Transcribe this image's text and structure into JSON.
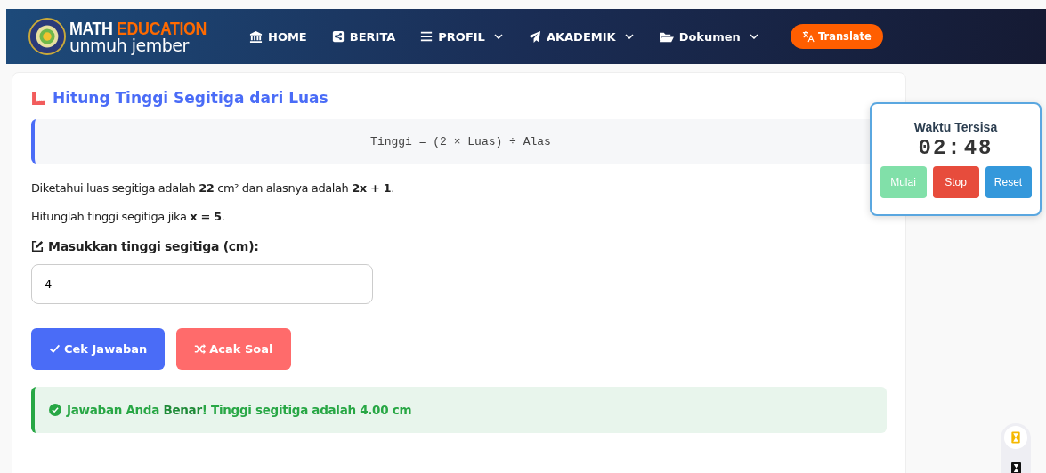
{
  "brand": {
    "word_1": "MATH",
    "word_2": "EDUCATION",
    "subtitle": "unmuh jember"
  },
  "nav": [
    {
      "label": "HOME",
      "kind": "home",
      "dropdown": false
    },
    {
      "label": "BERITA",
      "kind": "news",
      "dropdown": false
    },
    {
      "label": "PROFIL",
      "kind": "profile",
      "dropdown": true
    },
    {
      "label": "AKADEMIK",
      "kind": "academic",
      "dropdown": true
    },
    {
      "label": "Dokumen",
      "kind": "documents",
      "dropdown": true
    }
  ],
  "translate_button": "Translate",
  "card": {
    "title": "Hitung Tinggi Segitiga dari Luas",
    "formula": "Tinggi = (2 × Luas) ÷ Alas",
    "paragraphs": [
      "Diketahui luas segitiga adalah **22** cm² dan alasnya adalah **2x + 1**.",
      "Hitunglah tinggi segitiga jika **x = 5**."
    ],
    "input_label": "Masukkan tinggi segitiga (cm):",
    "input_value": "4",
    "buttons": [
      {
        "label": "Cek Jawaban",
        "kind": "check"
      },
      {
        "label": "Acak Soal",
        "kind": "shuffle"
      }
    ],
    "result": {
      "correct": true,
      "text": "Jawaban Anda **Benar**! Tinggi segitiga adalah 4.00 cm"
    }
  },
  "timer": {
    "title": "Waktu Tersisa",
    "time": "02:48",
    "buttons": [
      {
        "label": "Mulai",
        "kind": "start",
        "disabled": true
      },
      {
        "label": "Stop",
        "kind": "stop",
        "disabled": false
      },
      {
        "label": "Reset",
        "kind": "reset",
        "disabled": false
      }
    ]
  }
}
